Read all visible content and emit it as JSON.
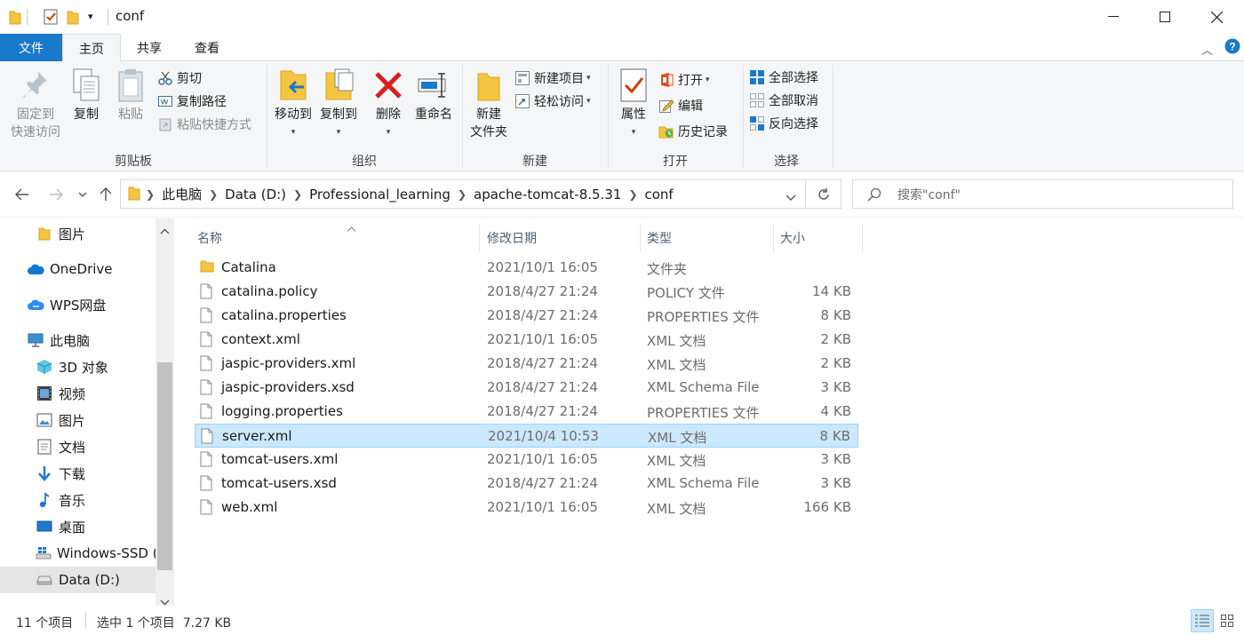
{
  "window": {
    "title": "conf",
    "controls": [
      "minimize",
      "maximize",
      "close"
    ]
  },
  "ribbon_tabs": [
    {
      "label": "文件",
      "state": "file"
    },
    {
      "label": "主页",
      "state": "selected"
    },
    {
      "label": "共享",
      "state": ""
    },
    {
      "label": "查看",
      "state": ""
    }
  ],
  "ribbon": {
    "clipboard": {
      "label": "剪贴板",
      "pin_line1": "固定到",
      "pin_line2": "快速访问",
      "copy": "复制",
      "paste": "粘贴",
      "cut": "剪切",
      "copy_path": "复制路径",
      "paste_shortcut": "粘贴快捷方式"
    },
    "organize": {
      "label": "组织",
      "move_to": "移动到",
      "copy_to": "复制到",
      "delete": "删除",
      "rename": "重命名"
    },
    "new": {
      "label": "新建",
      "new_folder_line1": "新建",
      "new_folder_line2": "文件夹",
      "new_item": "新建项目",
      "easy_access": "轻松访问"
    },
    "open": {
      "label": "打开",
      "properties": "属性",
      "open": "打开",
      "edit": "编辑",
      "history": "历史记录"
    },
    "select": {
      "label": "选择",
      "select_all": "全部选择",
      "select_none": "全部取消",
      "invert": "反向选择"
    }
  },
  "address": {
    "breadcrumbs": [
      "此电脑",
      "Data (D:)",
      "Professional_learning",
      "apache-tomcat-8.5.31",
      "conf"
    ],
    "search_placeholder": "搜索\"conf\""
  },
  "nav_pane": [
    {
      "label": "图片",
      "icon": "folder-icon",
      "indent": 1,
      "selected": false
    },
    {
      "label": "OneDrive",
      "icon": "onedrive-cloud-icon",
      "indent": 0,
      "selected": false
    },
    {
      "label": "WPS网盘",
      "icon": "wps-cloud-icon",
      "indent": 0,
      "selected": false
    },
    {
      "label": "此电脑",
      "icon": "this-pc-icon",
      "indent": 0,
      "selected": false
    },
    {
      "label": "3D 对象",
      "icon": "3d-objects-icon",
      "indent": 1,
      "selected": false
    },
    {
      "label": "视频",
      "icon": "videos-icon",
      "indent": 1,
      "selected": false
    },
    {
      "label": "图片",
      "icon": "pictures-icon",
      "indent": 1,
      "selected": false
    },
    {
      "label": "文档",
      "icon": "documents-icon",
      "indent": 1,
      "selected": false
    },
    {
      "label": "下载",
      "icon": "downloads-icon",
      "indent": 1,
      "selected": false
    },
    {
      "label": "音乐",
      "icon": "music-icon",
      "indent": 1,
      "selected": false
    },
    {
      "label": "桌面",
      "icon": "desktop-icon",
      "indent": 1,
      "selected": false
    },
    {
      "label": "Windows-SSD (",
      "icon": "windows-drive-icon",
      "indent": 1,
      "selected": false
    },
    {
      "label": "Data (D:)",
      "icon": "drive-icon",
      "indent": 1,
      "selected": true
    }
  ],
  "columns": {
    "name": "名称",
    "date": "修改日期",
    "type": "类型",
    "size": "大小"
  },
  "files": [
    {
      "name": "Catalina",
      "date": "2021/10/1 16:05",
      "type": "文件夹",
      "size": "",
      "kind": "folder",
      "selected": false
    },
    {
      "name": "catalina.policy",
      "date": "2018/4/27 21:24",
      "type": "POLICY 文件",
      "size": "14 KB",
      "kind": "file",
      "selected": false
    },
    {
      "name": "catalina.properties",
      "date": "2018/4/27 21:24",
      "type": "PROPERTIES 文件",
      "size": "8 KB",
      "kind": "file",
      "selected": false
    },
    {
      "name": "context.xml",
      "date": "2021/10/1 16:05",
      "type": "XML 文档",
      "size": "2 KB",
      "kind": "file",
      "selected": false
    },
    {
      "name": "jaspic-providers.xml",
      "date": "2018/4/27 21:24",
      "type": "XML 文档",
      "size": "2 KB",
      "kind": "file",
      "selected": false
    },
    {
      "name": "jaspic-providers.xsd",
      "date": "2018/4/27 21:24",
      "type": "XML Schema File",
      "size": "3 KB",
      "kind": "file",
      "selected": false
    },
    {
      "name": "logging.properties",
      "date": "2018/4/27 21:24",
      "type": "PROPERTIES 文件",
      "size": "4 KB",
      "kind": "file",
      "selected": false
    },
    {
      "name": "server.xml",
      "date": "2021/10/4 10:53",
      "type": "XML 文档",
      "size": "8 KB",
      "kind": "file",
      "selected": true
    },
    {
      "name": "tomcat-users.xml",
      "date": "2021/10/1 16:05",
      "type": "XML 文档",
      "size": "3 KB",
      "kind": "file",
      "selected": false
    },
    {
      "name": "tomcat-users.xsd",
      "date": "2018/4/27 21:24",
      "type": "XML Schema File",
      "size": "3 KB",
      "kind": "file",
      "selected": false
    },
    {
      "name": "web.xml",
      "date": "2021/10/1 16:05",
      "type": "XML 文档",
      "size": "166 KB",
      "kind": "file",
      "selected": false
    }
  ],
  "status": {
    "count": "11 个项目",
    "selection": "选中 1 个项目  7.27 KB"
  },
  "colors": {
    "accent": "#1979ca",
    "selection_bg": "#cce8ff",
    "selection_border": "#99d1ff",
    "folder": "#f5c542"
  }
}
